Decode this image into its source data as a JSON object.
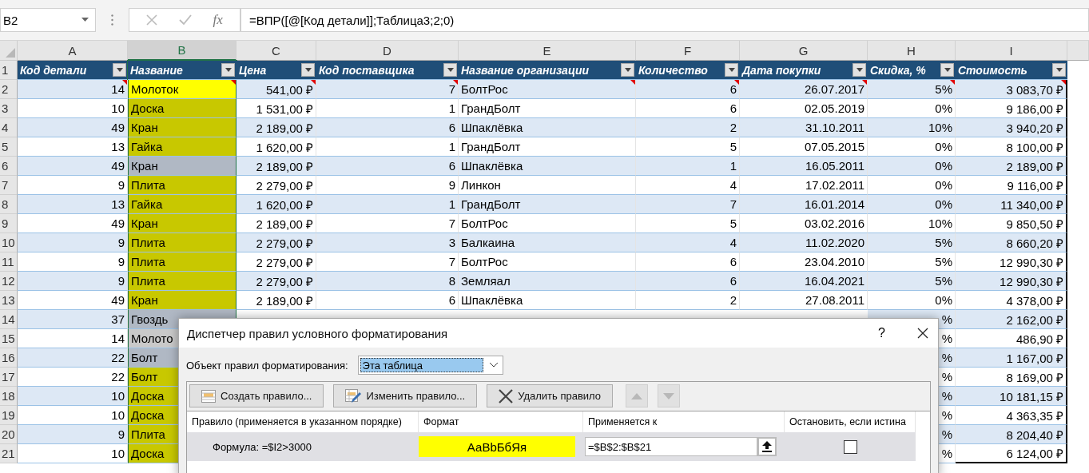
{
  "formula_bar": {
    "name_box": "B2",
    "function_label": "fx",
    "formula": "=ВПР([@[Код детали]];Таблица3;2;0)"
  },
  "table": {
    "columns": [
      {
        "letter": "A",
        "title": "Код детали",
        "selected": false
      },
      {
        "letter": "B",
        "title": "Название",
        "selected": true
      },
      {
        "letter": "C",
        "title": "Цена",
        "selected": false
      },
      {
        "letter": "D",
        "title": "Код поставщика",
        "selected": false
      },
      {
        "letter": "E",
        "title": "Название организации",
        "selected": false
      },
      {
        "letter": "F",
        "title": "Количество",
        "selected": false
      },
      {
        "letter": "G",
        "title": "Дата покупки",
        "selected": false
      },
      {
        "letter": "H",
        "title": "Скидка, %",
        "selected": false
      },
      {
        "letter": "I",
        "title": "Стоимость",
        "selected": false
      }
    ],
    "header_row_number": "1",
    "rows": [
      {
        "num": "2",
        "cells": [
          "14",
          "Молоток",
          "541,00 ₽",
          "7",
          "БолтРос",
          "6",
          "26.07.2017",
          "5%",
          "3 083,70 ₽"
        ],
        "highlighted": true,
        "active": true,
        "has_comments": true
      },
      {
        "num": "3",
        "cells": [
          "10",
          "Доска",
          "1 531,00 ₽",
          "1",
          "ГрандБолт",
          "6",
          "02.05.2019",
          "0%",
          "9 186,00 ₽"
        ],
        "highlighted": true,
        "active": false,
        "has_comments": false
      },
      {
        "num": "4",
        "cells": [
          "49",
          "Кран",
          "2 189,00 ₽",
          "6",
          "Шпаклёвка",
          "2",
          "31.10.2011",
          "10%",
          "3 940,20 ₽"
        ],
        "highlighted": true,
        "active": false,
        "has_comments": false
      },
      {
        "num": "5",
        "cells": [
          "13",
          "Гайка",
          "1 620,00 ₽",
          "1",
          "ГрандБолт",
          "5",
          "07.05.2015",
          "0%",
          "8 100,00 ₽"
        ],
        "highlighted": true,
        "active": false,
        "has_comments": false
      },
      {
        "num": "6",
        "cells": [
          "49",
          "Кран",
          "2 189,00 ₽",
          "6",
          "Шпаклёвка",
          "1",
          "16.05.2011",
          "0%",
          "2 189,00 ₽"
        ],
        "highlighted": false,
        "active": false,
        "has_comments": false
      },
      {
        "num": "7",
        "cells": [
          "9",
          "Плита",
          "2 279,00 ₽",
          "9",
          "Линкон",
          "4",
          "17.02.2011",
          "0%",
          "9 116,00 ₽"
        ],
        "highlighted": true,
        "active": false,
        "has_comments": false
      },
      {
        "num": "8",
        "cells": [
          "13",
          "Гайка",
          "1 620,00 ₽",
          "1",
          "ГрандБолт",
          "7",
          "16.01.2014",
          "0%",
          "11 340,00 ₽"
        ],
        "highlighted": true,
        "active": false,
        "has_comments": false
      },
      {
        "num": "9",
        "cells": [
          "49",
          "Кран",
          "2 189,00 ₽",
          "7",
          "БолтРос",
          "5",
          "03.02.2016",
          "10%",
          "9 850,50 ₽"
        ],
        "highlighted": true,
        "active": false,
        "has_comments": false
      },
      {
        "num": "10",
        "cells": [
          "9",
          "Плита",
          "2 279,00 ₽",
          "3",
          "Балкаина",
          "4",
          "11.02.2020",
          "5%",
          "8 660,20 ₽"
        ],
        "highlighted": true,
        "active": false,
        "has_comments": false
      },
      {
        "num": "11",
        "cells": [
          "9",
          "Плита",
          "2 279,00 ₽",
          "7",
          "БолтРос",
          "6",
          "23.04.2010",
          "5%",
          "12 990,30 ₽"
        ],
        "highlighted": true,
        "active": false,
        "has_comments": false
      },
      {
        "num": "12",
        "cells": [
          "9",
          "Плита",
          "2 279,00 ₽",
          "8",
          "Земляал",
          "6",
          "16.04.2021",
          "5%",
          "12 990,30 ₽"
        ],
        "highlighted": true,
        "active": false,
        "has_comments": false
      },
      {
        "num": "13",
        "cells": [
          "49",
          "Кран",
          "2 189,00 ₽",
          "6",
          "Шпаклёвка",
          "2",
          "27.08.2011",
          "0%",
          "4 378,00 ₽"
        ],
        "highlighted": true,
        "active": false,
        "has_comments": false
      }
    ],
    "partly_covered_rows": [
      {
        "num": "14",
        "a": "37",
        "b": "Гвоздь",
        "h": "%",
        "i": "2 162,00 ₽",
        "highlighted": false
      },
      {
        "num": "15",
        "a": "14",
        "b": "Молото",
        "h": "%",
        "i": "486,90 ₽",
        "highlighted": false
      },
      {
        "num": "16",
        "a": "22",
        "b": "Болт",
        "h": "%",
        "i": "1 167,00 ₽",
        "highlighted": false
      },
      {
        "num": "17",
        "a": "22",
        "b": "Болт",
        "h": "%",
        "i": "8 169,00 ₽",
        "highlighted": true
      },
      {
        "num": "18",
        "a": "10",
        "b": "Доска",
        "h": "%",
        "i": "10 181,15 ₽",
        "highlighted": true
      },
      {
        "num": "19",
        "a": "10",
        "b": "Доска",
        "h": "%",
        "i": "4 363,35 ₽",
        "highlighted": true
      },
      {
        "num": "20",
        "a": "9",
        "b": "Плита",
        "h": "%",
        "i": "8 204,40 ₽",
        "highlighted": true
      },
      {
        "num": "21",
        "a": "10",
        "b": "Доска",
        "h": "%",
        "i": "6 124,00 ₽",
        "highlighted": true
      }
    ]
  },
  "dialog": {
    "title": "Диспетчер правил условного форматирования",
    "help": "?",
    "scope_label": "Объект правил форматирования:",
    "scope_value": "Эта таблица",
    "buttons": [
      {
        "label": "Создать правило...",
        "kind": "create"
      },
      {
        "label": "Изменить правило...",
        "kind": "edit"
      },
      {
        "label": "Удалить правило",
        "kind": "delete"
      }
    ],
    "move_buttons": [
      {
        "kind": "up",
        "disabled": true
      },
      {
        "kind": "down",
        "disabled": true
      }
    ],
    "columns": [
      "Правило (применяется в указанном порядке)",
      "Формат",
      "Применяется к",
      "Остановить, если истина"
    ],
    "rules": [
      {
        "rule": "Формула: =$I2>3000",
        "preview": "АаBbБбЯя",
        "color": "#ffff00",
        "applies_to": "=$B$2:$B$21",
        "stop_if_true": false,
        "selected": true
      }
    ]
  }
}
